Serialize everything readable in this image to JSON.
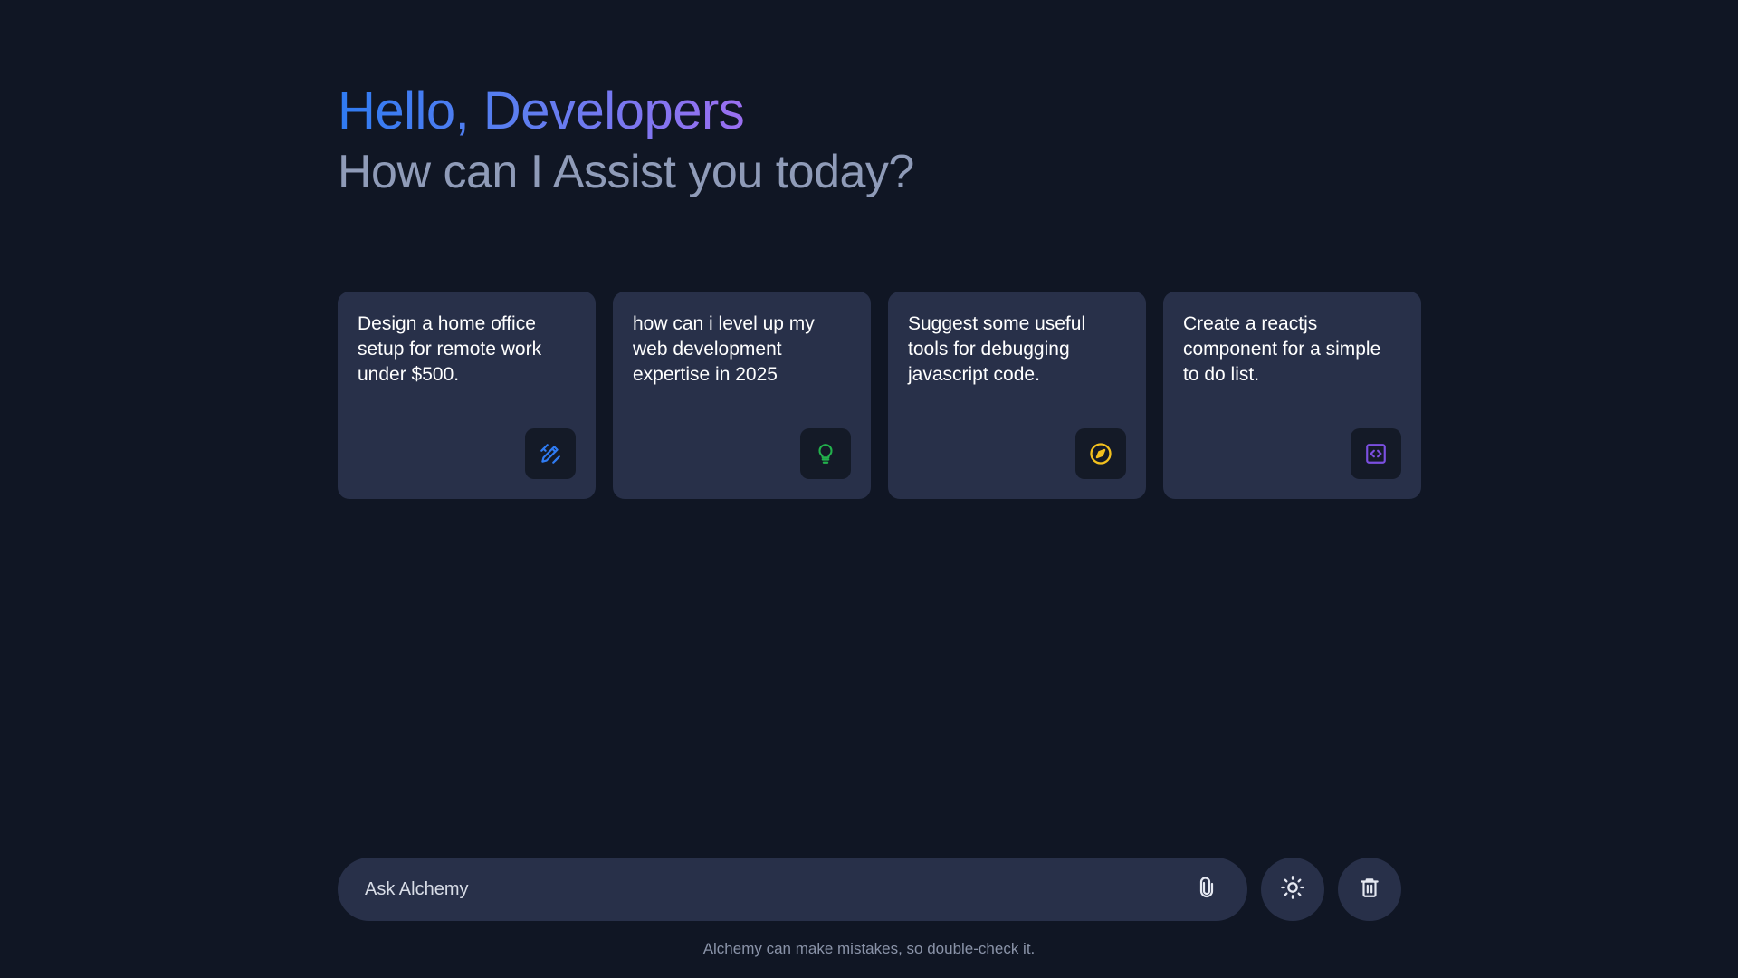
{
  "header": {
    "greeting": "Hello, Developers",
    "subtitle": "How can I Assist you today?"
  },
  "suggestions": [
    {
      "text": "Design a home office setup for remote work under $500.",
      "icon": "pencil-ruler-icon",
      "icon_color": "#2f7bf2"
    },
    {
      "text": "how can i level up my web development expertise in 2025",
      "icon": "lightbulb-icon",
      "icon_color": "#22b14c"
    },
    {
      "text": "Suggest some useful tools for debugging javascript code.",
      "icon": "compass-icon",
      "icon_color": "#f2c01e"
    },
    {
      "text": "Create a reactjs component for a simple to do list.",
      "icon": "code-icon",
      "icon_color": "#7b4fe0"
    }
  ],
  "prompt": {
    "placeholder": "Ask Alchemy",
    "attach_icon": "paperclip-icon"
  },
  "actions": {
    "theme_icon": "sun-icon",
    "delete_icon": "trash-icon"
  },
  "footer": {
    "disclaimer": "Alchemy can make mistakes, so double-check it."
  },
  "colors": {
    "background": "#101624",
    "card": "#283049",
    "accent_gradient_start": "#2f7bf2",
    "accent_gradient_end": "#9b6ff1"
  }
}
